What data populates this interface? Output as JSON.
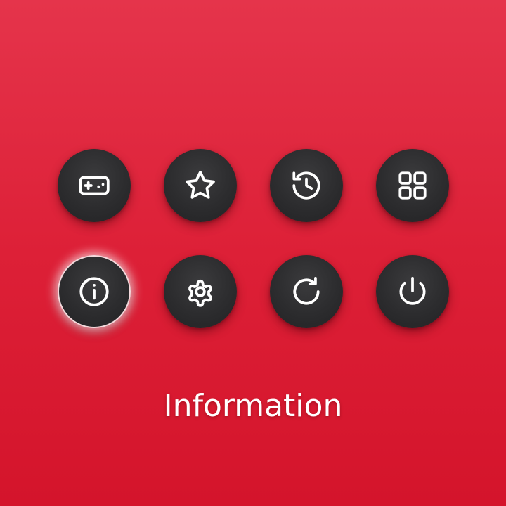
{
  "colors": {
    "background_top": "#e5344b",
    "background_bottom": "#d4142b",
    "button_fill": "#2c2c2e",
    "icon_stroke": "#ffffff",
    "selected_glow": "#f3d9dc"
  },
  "menu": {
    "buttons": [
      {
        "icon": "gamepad-icon"
      },
      {
        "icon": "star-icon"
      },
      {
        "icon": "history-icon"
      },
      {
        "icon": "apps-grid-icon"
      },
      {
        "icon": "info-icon",
        "selected": true
      },
      {
        "icon": "gear-icon"
      },
      {
        "icon": "refresh-icon"
      },
      {
        "icon": "power-icon"
      }
    ],
    "selected_label": "Information"
  }
}
